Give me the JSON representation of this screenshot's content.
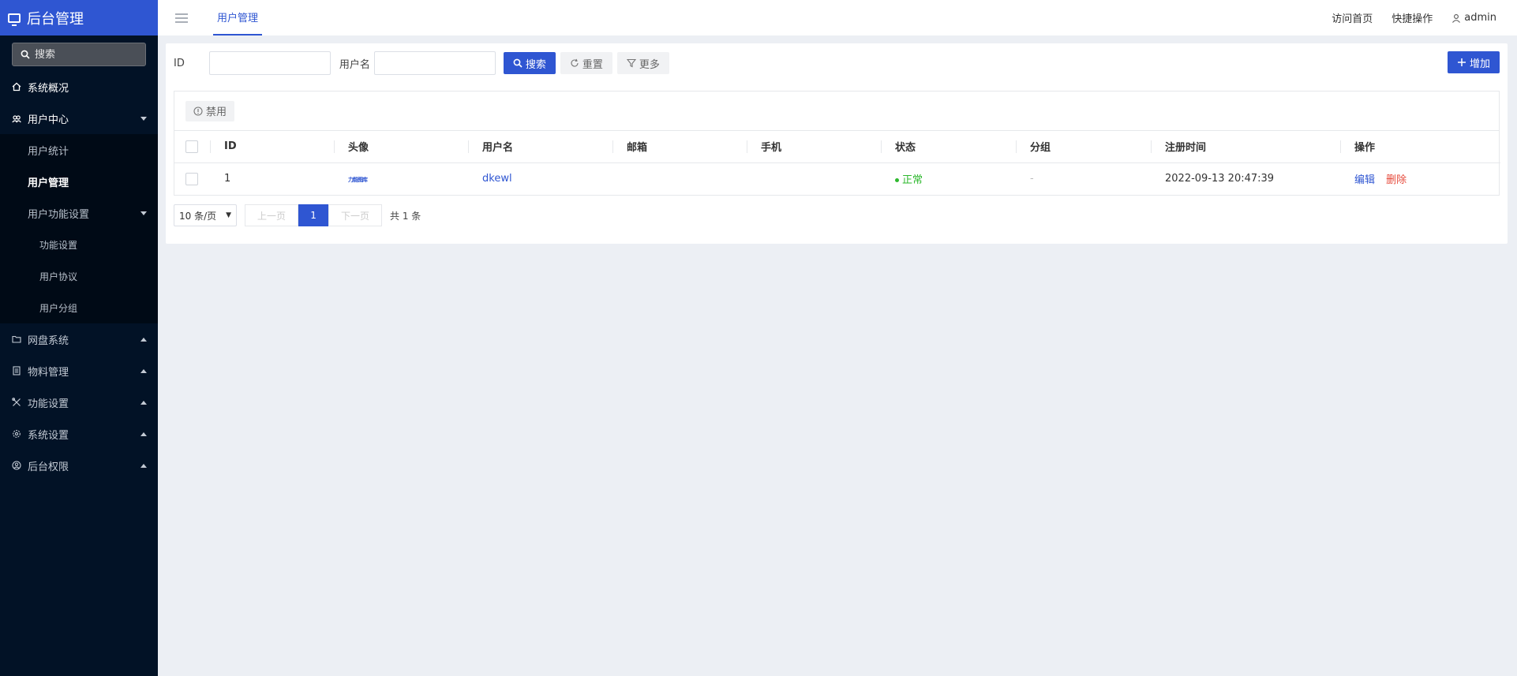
{
  "brand": {
    "title": "后台管理"
  },
  "sidebar": {
    "search_placeholder": "搜索",
    "items": [
      {
        "label": "系统概况"
      },
      {
        "label": "用户中心",
        "sub": [
          "用户统计",
          "用户管理",
          "用户功能设置"
        ],
        "subsub": [
          "功能设置",
          "用户协议",
          "用户分组"
        ]
      },
      {
        "label": "网盘系统"
      },
      {
        "label": "物料管理"
      },
      {
        "label": "功能设置"
      },
      {
        "label": "系统设置"
      },
      {
        "label": "后台权限"
      }
    ]
  },
  "header": {
    "tab": "用户管理",
    "links": [
      "访问首页",
      "快捷操作"
    ],
    "user": "admin"
  },
  "filters": {
    "id_label": "ID",
    "username_label": "用户名",
    "search": "搜索",
    "reset": "重置",
    "more": "更多",
    "add": "增加"
  },
  "toolbar": {
    "disable": "禁用"
  },
  "table": {
    "columns": [
      "ID",
      "头像",
      "用户名",
      "邮箱",
      "手机",
      "状态",
      "分组",
      "注册时间",
      "操作"
    ],
    "rows": [
      {
        "id": "1",
        "avatar_text": "力能图库",
        "username": "dkewl",
        "email": "",
        "phone": "",
        "status": "正常",
        "group": "-",
        "registered": "2022-09-13 20:47:39",
        "edit": "编辑",
        "delete": "删除"
      }
    ]
  },
  "pager": {
    "page_size": "10 条/页",
    "prev": "上一页",
    "current": "1",
    "next": "下一页",
    "total": "共 1 条"
  },
  "colors": {
    "accent": "#2f56d2",
    "sidebar_bg": "#021226",
    "success": "#2eb82e",
    "danger": "#e64a3b"
  }
}
